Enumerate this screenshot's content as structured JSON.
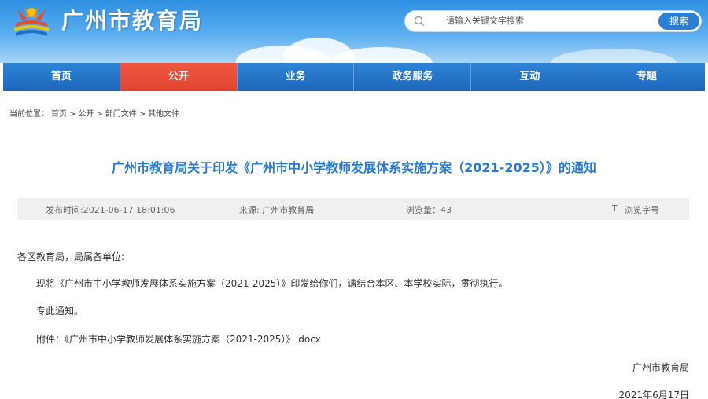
{
  "site": {
    "name": "广州市教育局"
  },
  "search": {
    "placeholder": "请输入关键文字搜索",
    "button_label": "搜索"
  },
  "nav": {
    "items": [
      {
        "label": "首页"
      },
      {
        "label": "公开"
      },
      {
        "label": "业务"
      },
      {
        "label": "政务服务"
      },
      {
        "label": "互动"
      },
      {
        "label": "专题"
      }
    ],
    "active_index": 1
  },
  "breadcrumb": {
    "prefix": "当前位置：",
    "items": [
      "首页",
      "公开",
      "部门文件",
      "其他文件"
    ],
    "separator": ">"
  },
  "article": {
    "title": "广州市教育局关于印发《广州市中小学教师发展体系实施方案（2021-2025）》的通知",
    "meta": {
      "published": "发布时间:2021-06-17 18:01:06",
      "source": "来源: 广州市教育局",
      "views": "浏览量：43",
      "font_toggle_icon": "T",
      "font_toggle_label": "浏览字号"
    },
    "salutation": "各区教育局，局属各单位:",
    "body": "现将《广州市中小学教师发展体系实施方案（2021-2025）》印发给你们，请结合本区、本学校实际，贯彻执行。",
    "closing": "专此通知。",
    "attachment_prefix": "附件：",
    "attachment_link": "《广州市中小学教师发展体系实施方案（2021-2025）》.docx",
    "signature": "广州市教育局",
    "date": "2021年6月17日"
  },
  "colors": {
    "header_blue": "#2f8fe0",
    "nav_blue": "#1f6fc4",
    "nav_active": "#e04530",
    "title_blue": "#2a7bd0"
  }
}
